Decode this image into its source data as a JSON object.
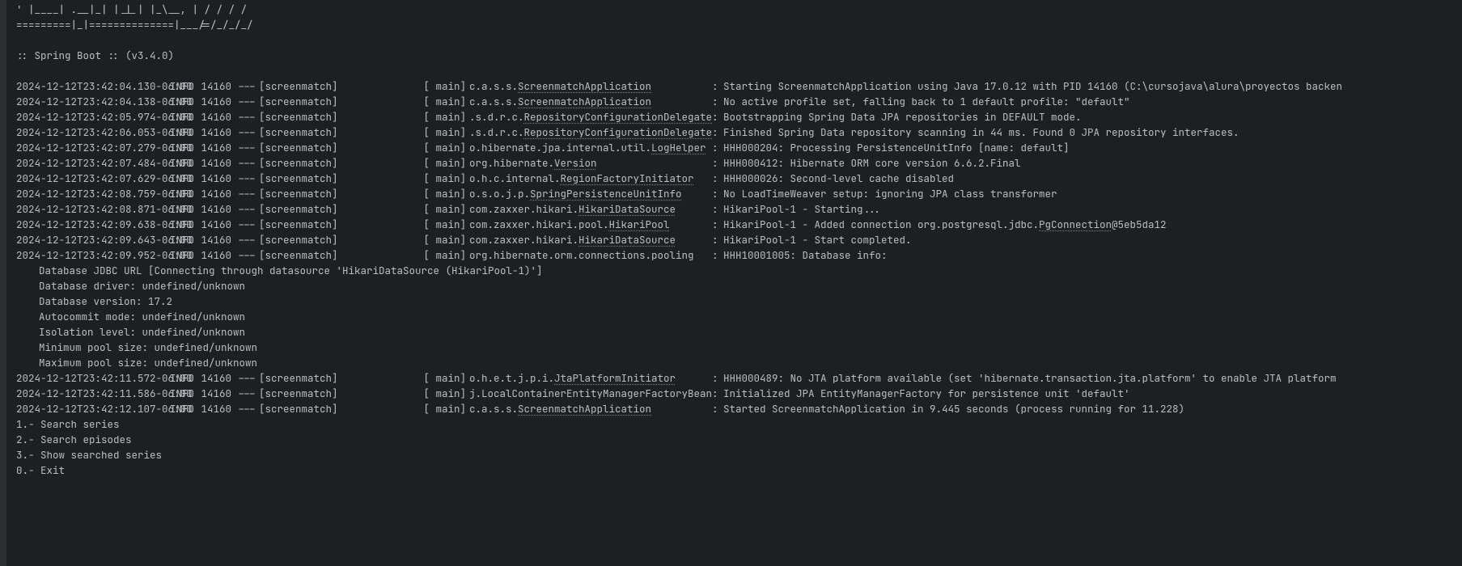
{
  "banner": [
    "  '  |____| .__|_| |_|_| |_\\__, | / / / /",
    " =========|_|==============|___/=/_/_/_/",
    "",
    " :: Spring Boot ::                (v3.4.0)",
    ""
  ],
  "logs": [
    {
      "ts": "2024-12-12T23:42:04.130-06:00",
      "lvl": "INFO",
      "pid": "14160",
      "app": "[screenmatch]",
      "thr": "[           main]",
      "loggerPlain": "c.a.s.s.",
      "loggerU": "ScreenmatchApplication",
      "msg": "Starting ScreenmatchApplication using Java 17.0.12 with PID 14160 (C:\\cursojava\\alura\\proyectos backen"
    },
    {
      "ts": "2024-12-12T23:42:04.138-06:00",
      "lvl": "INFO",
      "pid": "14160",
      "app": "[screenmatch]",
      "thr": "[           main]",
      "loggerPlain": "c.a.s.s.",
      "loggerU": "ScreenmatchApplication",
      "msg": "No active profile set, falling back to 1 default profile: \"default\""
    },
    {
      "ts": "2024-12-12T23:42:05.974-06:00",
      "lvl": "INFO",
      "pid": "14160",
      "app": "[screenmatch]",
      "thr": "[           main]",
      "loggerPlain": ".s.d.r.c.",
      "loggerU": "RepositoryConfigurationDelegate",
      "msg": "Bootstrapping Spring Data JPA repositories in DEFAULT mode."
    },
    {
      "ts": "2024-12-12T23:42:06.053-06:00",
      "lvl": "INFO",
      "pid": "14160",
      "app": "[screenmatch]",
      "thr": "[           main]",
      "loggerPlain": ".s.d.r.c.",
      "loggerU": "RepositoryConfigurationDelegate",
      "msg": "Finished Spring Data repository scanning in 44 ms. Found 0 JPA repository interfaces."
    },
    {
      "ts": "2024-12-12T23:42:07.279-06:00",
      "lvl": "INFO",
      "pid": "14160",
      "app": "[screenmatch]",
      "thr": "[           main]",
      "loggerPlain": "o.hibernate.jpa.internal.util.",
      "loggerU": "LogHelper",
      "msg": "HHH000204: Processing PersistenceUnitInfo [name: default]"
    },
    {
      "ts": "2024-12-12T23:42:07.484-06:00",
      "lvl": "INFO",
      "pid": "14160",
      "app": "[screenmatch]",
      "thr": "[           main]",
      "loggerPlain": "org.hibernate.",
      "loggerU": "Version",
      "msg": "HHH000412: Hibernate ORM core version 6.6.2.Final"
    },
    {
      "ts": "2024-12-12T23:42:07.629-06:00",
      "lvl": "INFO",
      "pid": "14160",
      "app": "[screenmatch]",
      "thr": "[           main]",
      "loggerPlain": "o.h.c.internal.",
      "loggerU": "RegionFactoryInitiator",
      "msg": "HHH000026: Second-level cache disabled"
    },
    {
      "ts": "2024-12-12T23:42:08.759-06:00",
      "lvl": "INFO",
      "pid": "14160",
      "app": "[screenmatch]",
      "thr": "[           main]",
      "loggerPlain": "o.s.o.j.p.",
      "loggerU": "SpringPersistenceUnitInfo",
      "msg": "No LoadTimeWeaver setup: ignoring JPA class transformer"
    },
    {
      "ts": "2024-12-12T23:42:08.871-06:00",
      "lvl": "INFO",
      "pid": "14160",
      "app": "[screenmatch]",
      "thr": "[           main]",
      "loggerPlain": "com.zaxxer.hikari.",
      "loggerU": "HikariDataSource",
      "msg": "HikariPool-1 - Starting..."
    },
    {
      "ts": "2024-12-12T23:42:09.638-06:00",
      "lvl": "INFO",
      "pid": "14160",
      "app": "[screenmatch]",
      "thr": "[           main]",
      "loggerPlain": "com.zaxxer.hikari.pool.",
      "loggerU": "HikariPool",
      "msgPlain": "HikariPool-1 - Added connection org.postgresql.jdbc.",
      "msgU": "PgConnection",
      "msgTail": "@5eb5da12"
    },
    {
      "ts": "2024-12-12T23:42:09.643-06:00",
      "lvl": "INFO",
      "pid": "14160",
      "app": "[screenmatch]",
      "thr": "[           main]",
      "loggerPlain": "com.zaxxer.hikari.",
      "loggerU": "HikariDataSource",
      "msg": "HikariPool-1 - Start completed."
    },
    {
      "ts": "2024-12-12T23:42:09.952-06:00",
      "lvl": "INFO",
      "pid": "14160",
      "app": "[screenmatch]",
      "thr": "[           main]",
      "loggerPlain": "org.hibernate.orm.connections.pooling",
      "loggerU": "",
      "msg": "HHH10001005: Database info:"
    }
  ],
  "dbinfo": [
    "Database JDBC URL [Connecting through datasource 'HikariDataSource (HikariPool-1)']",
    "Database driver: undefined/unknown",
    "Database version: 17.2",
    "Autocommit mode: undefined/unknown",
    "Isolation level: undefined/unknown",
    "Minimum pool size: undefined/unknown",
    "Maximum pool size: undefined/unknown"
  ],
  "logs2": [
    {
      "ts": "2024-12-12T23:42:11.572-06:00",
      "lvl": "INFO",
      "pid": "14160",
      "app": "[screenmatch]",
      "thr": "[           main]",
      "loggerPlain": "o.h.e.t.j.p.i.",
      "loggerU": "JtaPlatformInitiator",
      "msg": "HHH000489: No JTA platform available (set 'hibernate.transaction.jta.platform' to enable JTA platform"
    },
    {
      "ts": "2024-12-12T23:42:11.586-06:00",
      "lvl": "INFO",
      "pid": "14160",
      "app": "[screenmatch]",
      "thr": "[           main]",
      "loggerPlain": "j.LocalContainerEntityManagerFactoryBean",
      "loggerU": "",
      "msg": "Initialized JPA EntityManagerFactory for persistence unit 'default'"
    },
    {
      "ts": "2024-12-12T23:42:12.107-06:00",
      "lvl": "INFO",
      "pid": "14160",
      "app": "[screenmatch]",
      "thr": "[           main]",
      "loggerPlain": "c.a.s.s.",
      "loggerU": "ScreenmatchApplication",
      "msg": "Started ScreenmatchApplication in 9.445 seconds (process running for 11.228)"
    }
  ],
  "menu": [
    "1.- Search series",
    "2.- Search episodes",
    "3.- Show searched series",
    "0.- Exit"
  ]
}
